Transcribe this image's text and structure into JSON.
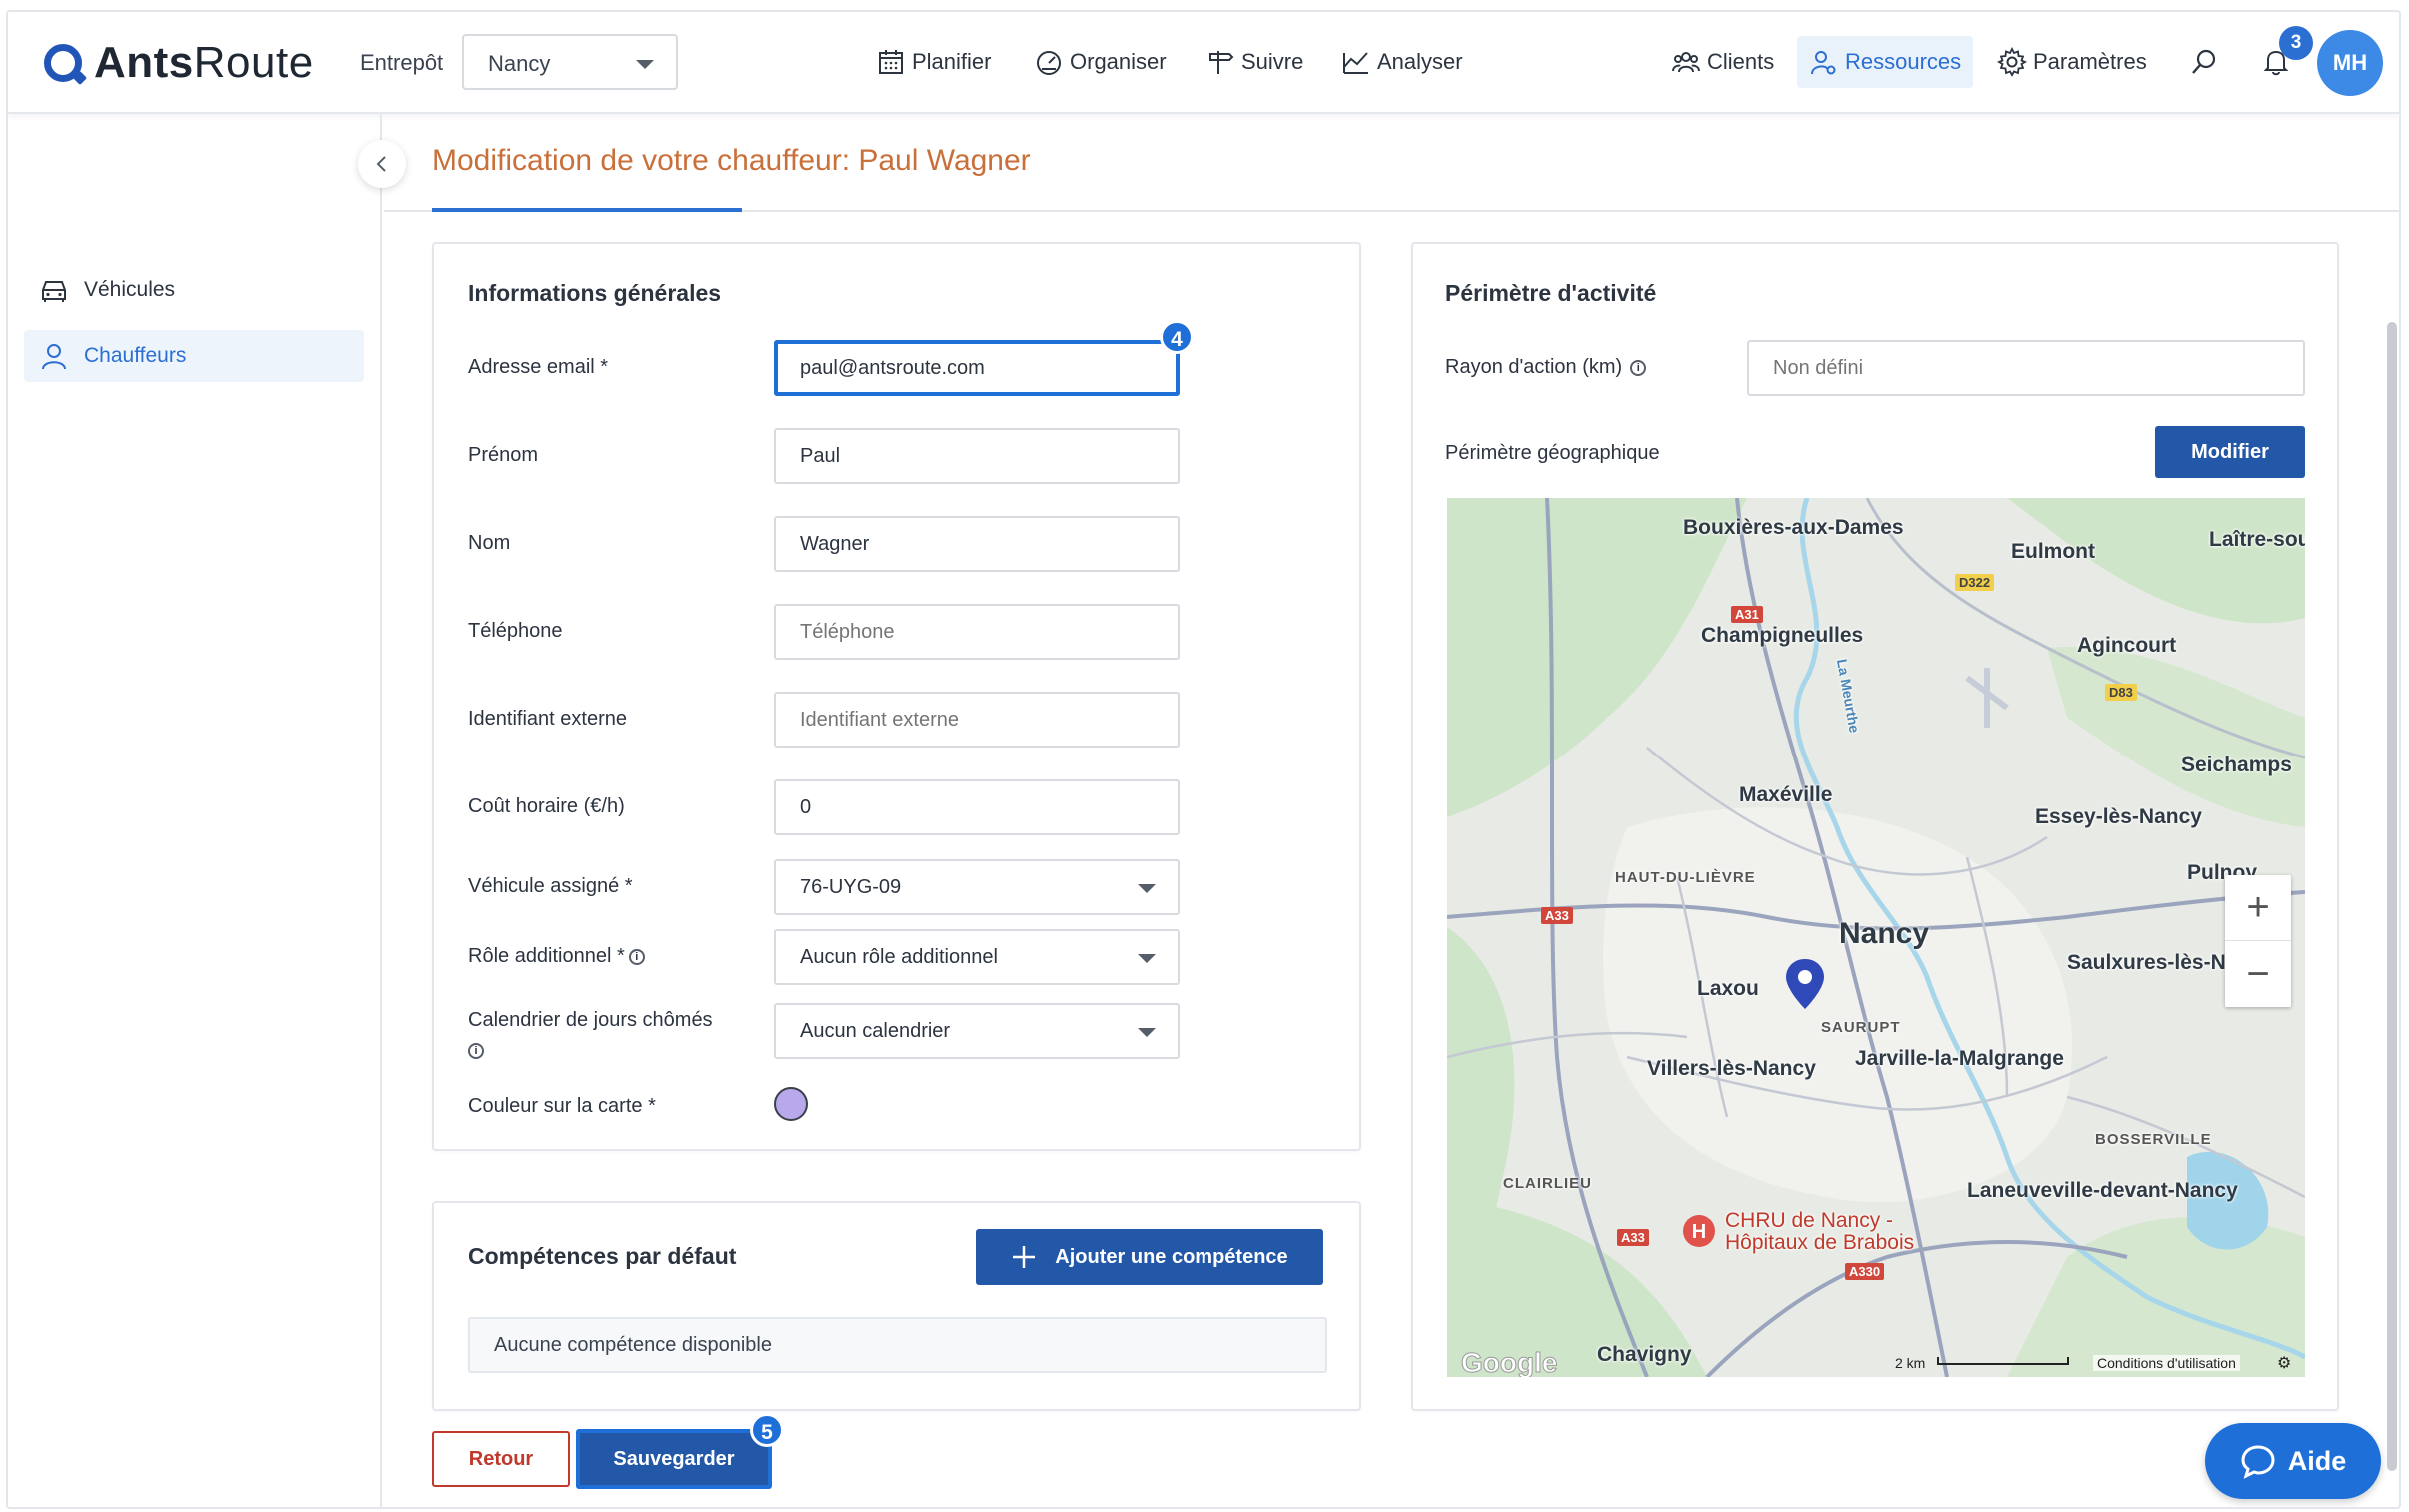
{
  "brand": {
    "name_bold": "Ants",
    "name_rest": "Route"
  },
  "topbar": {
    "warehouse_label": "Entrepôt",
    "warehouse_value": "Nancy",
    "nav": {
      "plan": "Planifier",
      "organize": "Organiser",
      "track": "Suivre",
      "analyze": "Analyser",
      "clients": "Clients",
      "resources": "Ressources",
      "settings": "Paramètres"
    },
    "notifications_count": "3",
    "avatar_initials": "MH"
  },
  "sidebar": {
    "items": [
      {
        "label": "Véhicules",
        "icon": "car-icon"
      },
      {
        "label": "Chauffeurs",
        "icon": "user-icon",
        "active": true
      }
    ]
  },
  "page": {
    "title": "Modification de votre chauffeur: Paul Wagner"
  },
  "general_info": {
    "title": "Informations générales",
    "email_label": "Adresse email *",
    "email_value": "paul@antsroute.com",
    "email_step": "4",
    "firstname_label": "Prénom",
    "firstname_value": "Paul",
    "lastname_label": "Nom",
    "lastname_value": "Wagner",
    "phone_label": "Téléphone",
    "phone_placeholder": "Téléphone",
    "external_id_label": "Identifiant externe",
    "external_id_placeholder": "Identifiant externe",
    "hourly_cost_label": "Coût horaire (€/h)",
    "hourly_cost_value": "0",
    "vehicle_label": "Véhicule assigné *",
    "vehicle_value": "76-UYG-09",
    "role_label": "Rôle additionnel *",
    "role_value": "Aucun rôle additionnel",
    "calendar_label": "Calendrier de jours chômés",
    "calendar_value": "Aucun calendrier",
    "color_label": "Couleur sur la carte *",
    "color_value": "#b7a9ec"
  },
  "skills": {
    "title": "Compétences par défaut",
    "add_button": "Ajouter une compétence",
    "empty_text": "Aucune compétence disponible"
  },
  "actions": {
    "back": "Retour",
    "save": "Sauvegarder",
    "save_step": "5"
  },
  "perimeter": {
    "title": "Périmètre d'activité",
    "radius_label": "Rayon d'action (km)",
    "radius_placeholder": "Non défini",
    "geo_label": "Périmètre géographique",
    "modify_button": "Modifier",
    "map": {
      "places": {
        "bouxieres": "Bouxières-aux-Dames",
        "eulmont": "Eulmont",
        "laitre": "Laître-sou",
        "champigneulles": "Champigneulles",
        "agincourt": "Agincourt",
        "maxeville": "Maxéville",
        "seichamps": "Seichamps",
        "essey": "Essey-lès-Nancy",
        "pulnoy": "Pulnoy",
        "haut_du_lievre": "HAUT-DU-LIÈVRE",
        "nancy": "Nancy",
        "saulxures": "Saulxures-lès-N",
        "laxou": "Laxou",
        "saurupt": "SAURUPT",
        "villers": "Villers-lès-Nancy",
        "jarville": "Jarville-la-Malgrange",
        "bosserville": "BOSSERVILLE",
        "clairlieu": "CLAIRLIEU",
        "laneuveville": "Laneuveville-devant-Nancy",
        "chru_line1": "CHRU de Nancy -",
        "chru_line2": "Hôpitaux de Brabois",
        "chavigny": "Chavigny",
        "river": "La Meurthe"
      },
      "roads": {
        "a31": "A31",
        "d322": "D322",
        "d83": "D83",
        "a33_west": "A33",
        "a33_south": "A33",
        "a330": "A330"
      },
      "google": "Google",
      "scale": "2 km",
      "terms": "Conditions d'utilisation"
    }
  },
  "help": {
    "label": "Aide"
  }
}
